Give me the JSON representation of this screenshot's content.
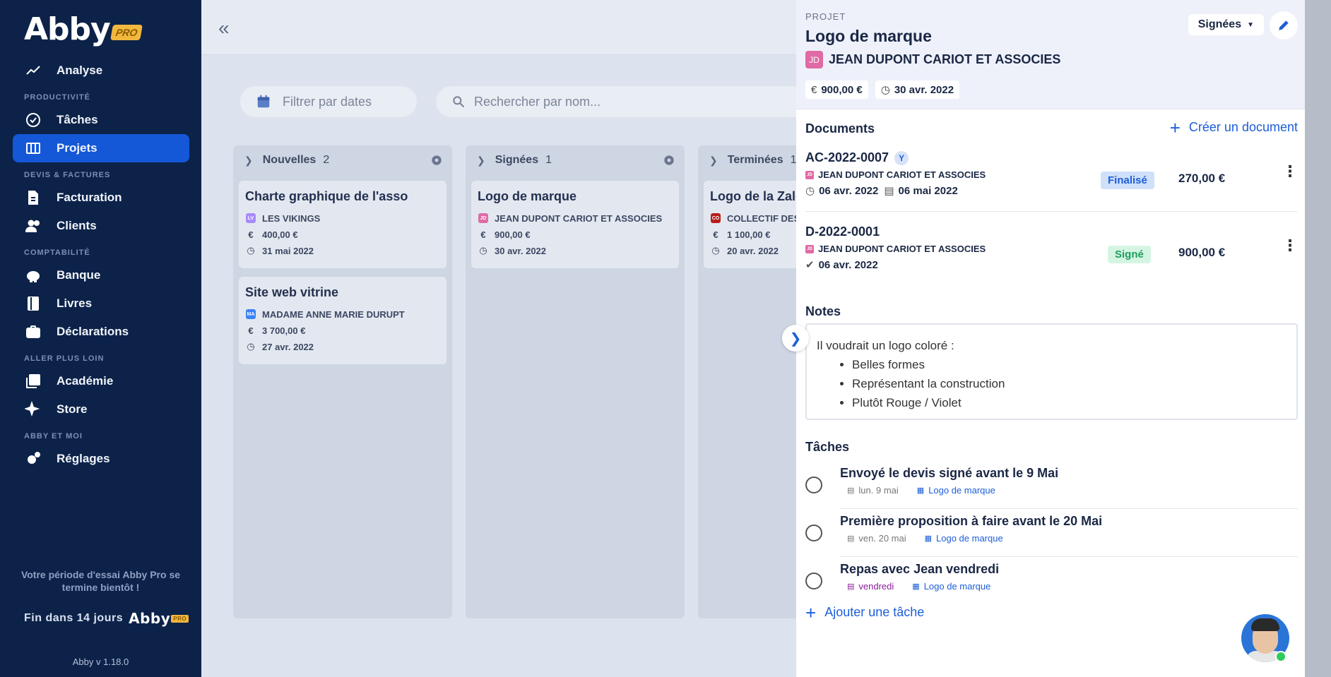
{
  "sidebar": {
    "logo": "Abby",
    "logo_pro": "PRO",
    "analyse": "Analyse",
    "sec_productivite": "PRODUCTIVITÉ",
    "taches": "Tâches",
    "projets": "Projets",
    "sec_devis": "DEVIS & FACTURES",
    "facturation": "Facturation",
    "clients": "Clients",
    "sec_compta": "COMPTABILITÉ",
    "banque": "Banque",
    "livres": "Livres",
    "declarations": "Déclarations",
    "sec_aller": "ALLER PLUS LOIN",
    "academie": "Académie",
    "store": "Store",
    "sec_abby": "ABBY ET MOI",
    "reglages": "Réglages",
    "trial_text": "Votre période d'essai Abby Pro se termine bientôt !",
    "trial_end": "Fin dans 14 jours",
    "version": "Abby v 1.18.0"
  },
  "main": {
    "collapse": "«",
    "filter_dates": "Filtrer par dates",
    "search_placeholder": "Rechercher par nom...",
    "columns": [
      {
        "name": "Nouvelles",
        "count": "2",
        "cards": [
          {
            "title": "Charte graphique de l'asso",
            "badge": "LV",
            "badge_color": "#a78bfa",
            "client": "LES VIKINGS",
            "amount": "400,00 €",
            "date": "31 mai 2022"
          },
          {
            "title": "Site web vitrine",
            "badge": "MA",
            "badge_color": "#3b82f6",
            "client": "MADAME ANNE MARIE DURUPT",
            "amount": "3 700,00 €",
            "date": "27 avr. 2022"
          }
        ]
      },
      {
        "name": "Signées",
        "count": "1",
        "cards": [
          {
            "title": "Logo de marque",
            "badge": "JD",
            "badge_color": "#e06aa4",
            "client": "JEAN DUPONT CARIOT ET ASSOCIES",
            "amount": "900,00 €",
            "date": "30 avr. 2022"
          }
        ]
      },
      {
        "name": "Terminées",
        "count": "1",
        "cards": [
          {
            "title": "Logo de la Zalo",
            "badge": "CO",
            "badge_color": "#b91c1c",
            "client": "COLLECTIF DES",
            "amount": "1 100,00 €",
            "date": "20 avr. 2022"
          }
        ]
      }
    ]
  },
  "panel": {
    "label": "PROJET",
    "title": "Logo de marque",
    "client_initials": "JD",
    "client": "JEAN DUPONT CARIOT ET ASSOCIES",
    "amount": "900,00 €",
    "date": "30 avr. 2022",
    "status": "Signées",
    "documents_title": "Documents",
    "create_document": "Créer un document",
    "documents": [
      {
        "number": "AC-2022-0007",
        "y_badge": "Y",
        "initials": "JD",
        "client": "JEAN DUPONT CARIOT ET ASSOCIES",
        "date1": "06 avr. 2022",
        "date2": "06 mai 2022",
        "status": "Finalisé",
        "amount": "270,00 €"
      },
      {
        "number": "D-2022-0001",
        "initials": "JD",
        "client": "JEAN DUPONT CARIOT ET ASSOCIES",
        "date1": "06 avr. 2022",
        "status": "Signé",
        "amount": "900,00 €"
      }
    ],
    "notes_title": "Notes",
    "notes_intro": "Il voudrait un logo coloré :",
    "notes_items": [
      "Belles formes",
      "Représentant la construction",
      "Plutôt Rouge / Violet"
    ],
    "tasks_title": "Tâches",
    "tasks": [
      {
        "title": "Envoyé le devis signé avant le 9 Mai",
        "date": "lun. 9 mai",
        "project": "Logo de marque"
      },
      {
        "title": "Première proposition à faire avant le 20 Mai",
        "date": "ven. 20 mai",
        "project": "Logo de marque"
      },
      {
        "title": "Repas avec Jean vendredi",
        "date": "vendredi",
        "project": "Logo de marque"
      }
    ],
    "add_task": "Ajouter une tâche"
  },
  "colors": {
    "sidebar_bg": "#0c2249",
    "accent": "#1458d8",
    "link": "#1d5ed8",
    "finalise_bg": "#cfe0fb",
    "signe_bg": "#d5f5e3",
    "client_badge": "#e06aa4"
  }
}
